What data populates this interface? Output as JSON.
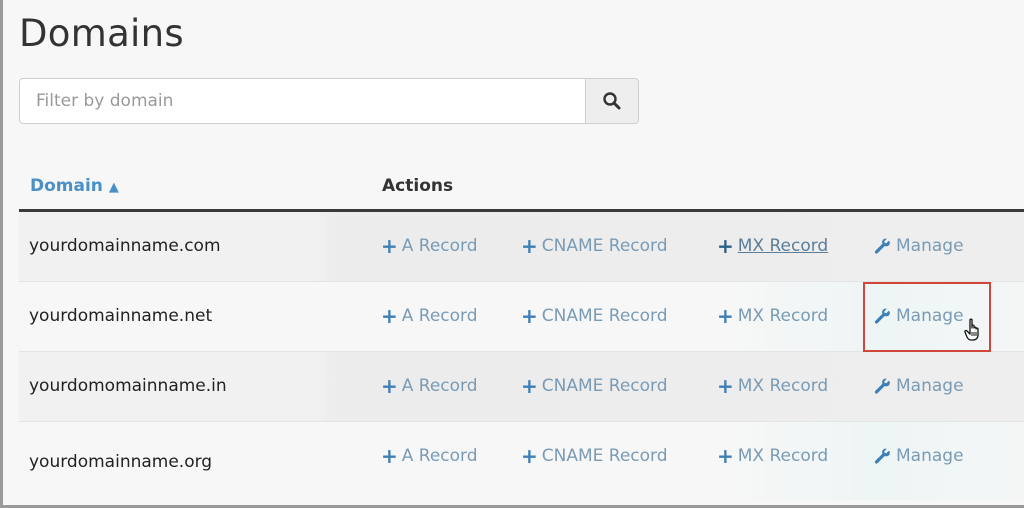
{
  "page": {
    "title": "Domains"
  },
  "filter": {
    "placeholder": "Filter by domain",
    "value": "",
    "search_icon": "search-icon"
  },
  "table": {
    "columns": [
      {
        "label": "Domain",
        "sort": "ascending",
        "sort_indicator": "▲"
      },
      {
        "label": "Actions"
      }
    ],
    "action_labels": {
      "a_record": "A Record",
      "cname_record": "CNAME Record",
      "mx_record": "MX Record",
      "manage": "Manage"
    },
    "action_icons": {
      "add": "plus-icon",
      "manage": "wrench-icon"
    },
    "rows": [
      {
        "domain": "yourdomainname.com",
        "mx_hovered": true
      },
      {
        "domain": "yourdomainname.net",
        "manage_highlighted": true
      },
      {
        "domain": "yourdomomainname.in"
      },
      {
        "domain": "yourdomainname.org"
      }
    ]
  },
  "colors": {
    "link": "#7a9bb5",
    "icon_blue": "#3d7fb6",
    "header_link": "#4a90c8",
    "highlight_border": "#d0473a"
  },
  "cursor": "pointer-hand-icon"
}
